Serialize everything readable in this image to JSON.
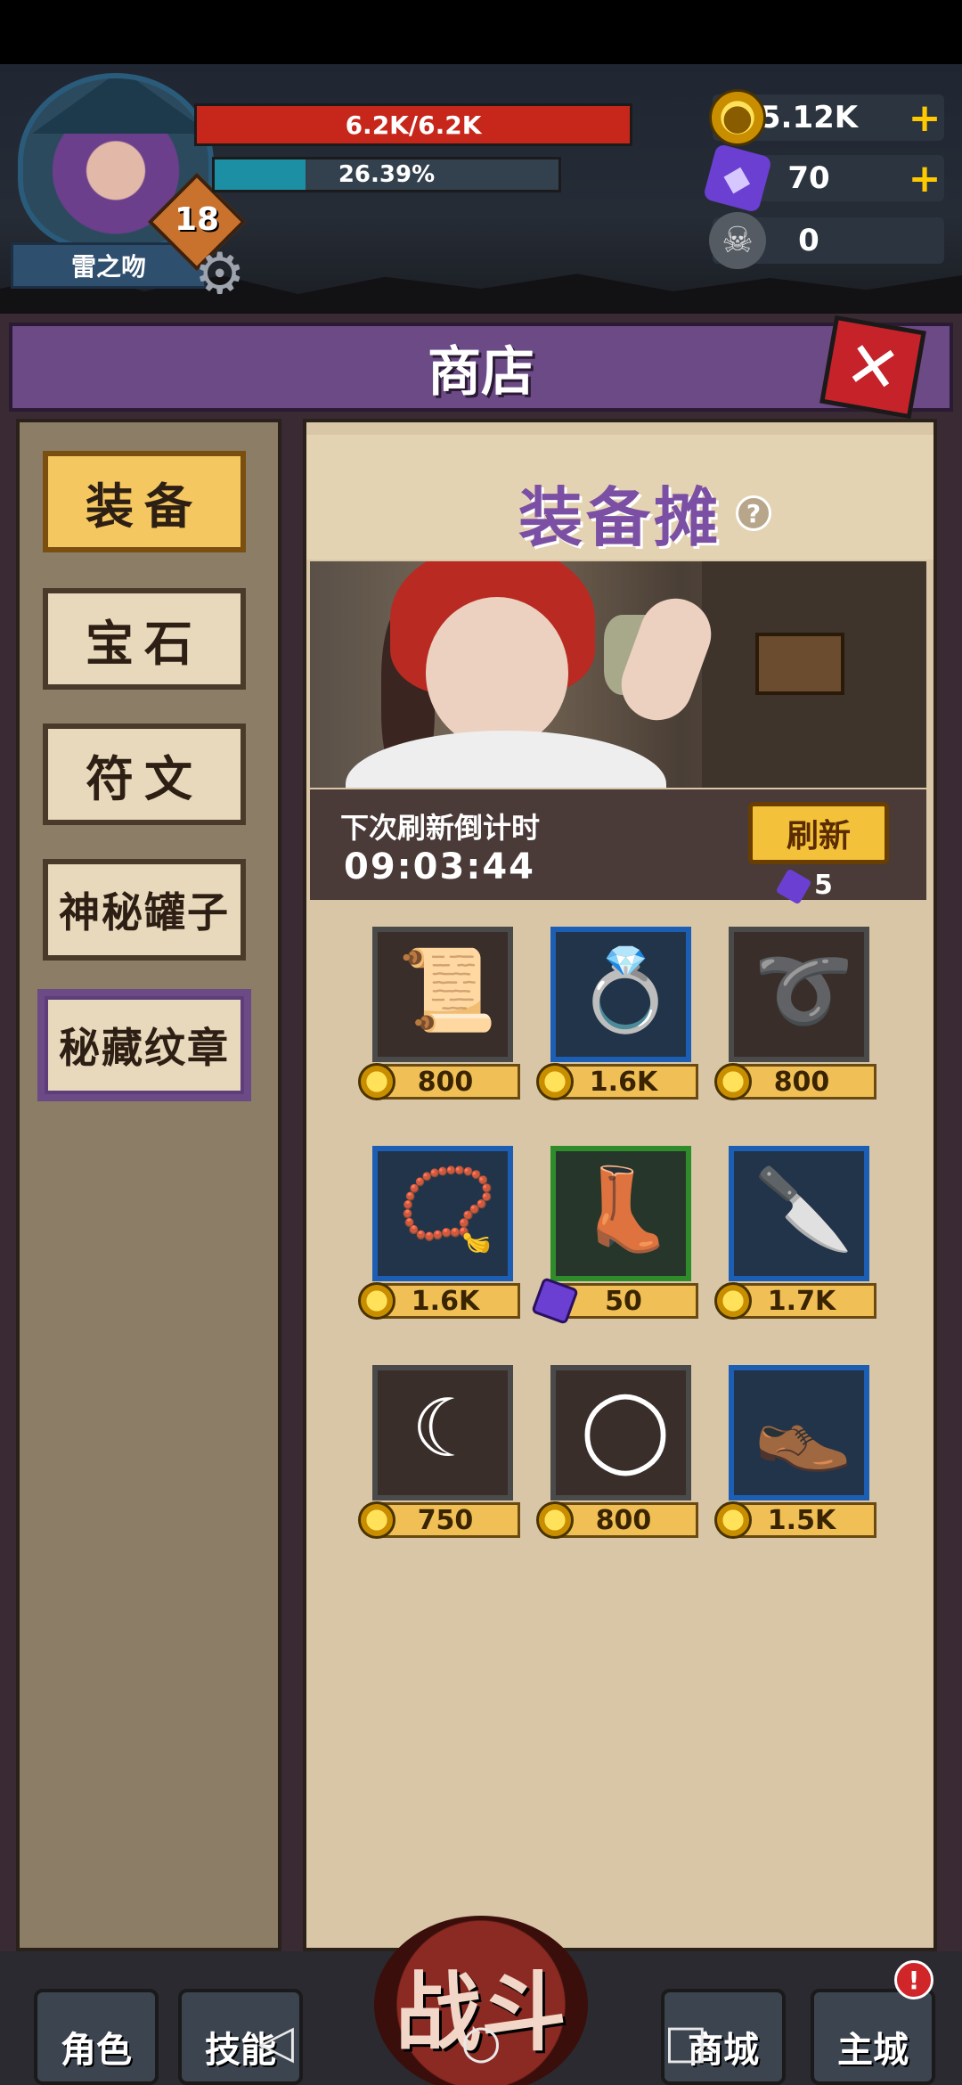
{
  "player": {
    "name": "雷之吻",
    "level": "18",
    "hp_text": "6.2K/6.2K",
    "xp_text": "26.39%",
    "xp_fraction": 0.2639
  },
  "resources": {
    "gold": "5.12K",
    "gems": "70",
    "horns": "0",
    "plus": "+"
  },
  "shop": {
    "title": "商店",
    "close_label": "✕",
    "tabs": [
      {
        "label": "装备",
        "active": true
      },
      {
        "label": "宝石",
        "active": false
      },
      {
        "label": "符文",
        "active": false
      },
      {
        "label": "神秘罐子",
        "active": false
      },
      {
        "label": "秘藏纹章",
        "active": false
      }
    ],
    "stall_title": "装备摊",
    "help_label": "?",
    "refresh_label": "下次刷新倒计时",
    "refresh_timer": "09:03:44",
    "refresh_button": "刷新",
    "refresh_cost": "5",
    "items": [
      {
        "icon": "scroll-icon",
        "glyph": "📜",
        "rarity": "common",
        "currency": "gold",
        "price": "800"
      },
      {
        "icon": "gold-ring-icon",
        "glyph": "💍",
        "rarity": "rare",
        "currency": "gold",
        "price": "1.6K"
      },
      {
        "icon": "belt-icon",
        "glyph": "➰",
        "rarity": "common",
        "currency": "gold",
        "price": "800"
      },
      {
        "icon": "necklace-icon",
        "glyph": "📿",
        "rarity": "rare",
        "currency": "gold",
        "price": "1.6K"
      },
      {
        "icon": "boots-icon",
        "glyph": "👢",
        "rarity": "epic",
        "currency": "gem",
        "price": "50"
      },
      {
        "icon": "knife-icon",
        "glyph": "🔪",
        "rarity": "rare",
        "currency": "gold",
        "price": "1.7K"
      },
      {
        "icon": "sickle-icon",
        "glyph": "☾",
        "rarity": "common",
        "currency": "gold",
        "price": "750"
      },
      {
        "icon": "pearl-necklace-icon",
        "glyph": "◯",
        "rarity": "common",
        "currency": "gold",
        "price": "800"
      },
      {
        "icon": "leather-boots-icon",
        "glyph": "👞",
        "rarity": "rare",
        "currency": "gold",
        "price": "1.5K"
      }
    ]
  },
  "nav": {
    "character": "角色",
    "skills": "技能",
    "battle": "战斗",
    "store": "商城",
    "main_city": "主城",
    "main_city_badge": "!"
  },
  "system_nav": {
    "back": "◁",
    "home": "○",
    "recents": "□"
  },
  "colors": {
    "hp": "#c7261a",
    "xp": "#1d8fa5",
    "accent_purple": "#6b4a86",
    "stall_title": "#7b4fa3",
    "gold": "#f0c057"
  }
}
